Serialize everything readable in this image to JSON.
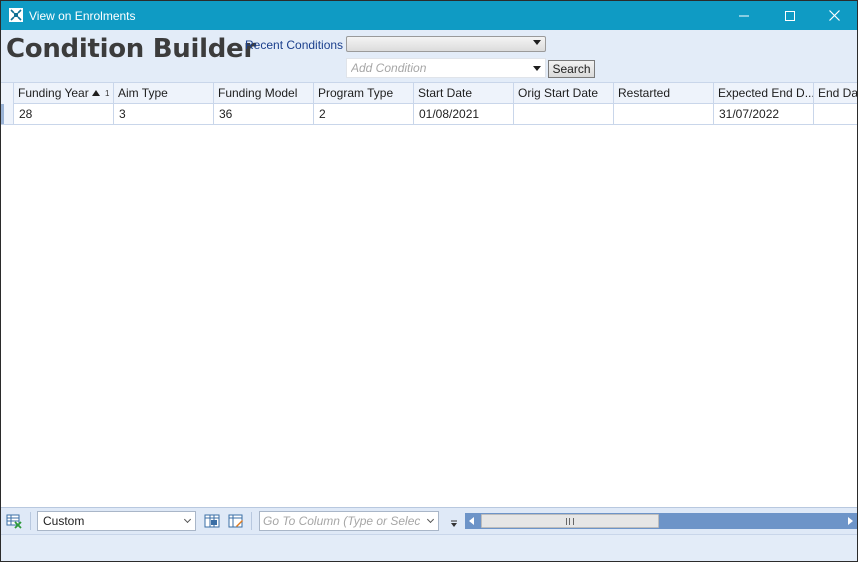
{
  "window": {
    "title": "View on Enrolments",
    "icons": {
      "app": "app-grid-icon",
      "minimize": "minimize-icon",
      "maximize": "maximize-icon",
      "close": "close-icon"
    }
  },
  "header": {
    "title": "Condition Builder",
    "recent_conditions_label": "Recent Conditions",
    "recent_conditions_value": "",
    "add_condition_placeholder": "Add Condition",
    "search_label": "Search"
  },
  "grid": {
    "columns": [
      {
        "label": "Funding Year",
        "sorted": "ascending",
        "sort_index": "1"
      },
      {
        "label": "Aim Type"
      },
      {
        "label": "Funding Model"
      },
      {
        "label": "Program Type"
      },
      {
        "label": "Start Date"
      },
      {
        "label": "Orig Start Date"
      },
      {
        "label": "Restarted"
      },
      {
        "label": "Expected End D..."
      },
      {
        "label": "End Dat"
      }
    ],
    "rows": [
      {
        "cells": [
          "28",
          "3",
          "36",
          "2",
          "01/08/2021",
          "",
          "",
          "31/07/2022",
          ""
        ]
      }
    ],
    "colors": {
      "header_bg": "#eef3fb",
      "grid_line": "#c9d6ea",
      "row_marker": "#9ab3d6"
    }
  },
  "toolbar": {
    "view_icon": "grid-view-icon",
    "view_value": "Custom",
    "column_chooser_icon": "column-chooser-icon",
    "edit_columns_icon": "edit-columns-icon",
    "goto_placeholder": "Go To Column (Type or Select)",
    "more_icon": "overflow-icon"
  },
  "theme": {
    "titlebar": "#0f9bc4",
    "header_bg": "#e3ecf8",
    "scrollbar": "#6d94c8"
  }
}
